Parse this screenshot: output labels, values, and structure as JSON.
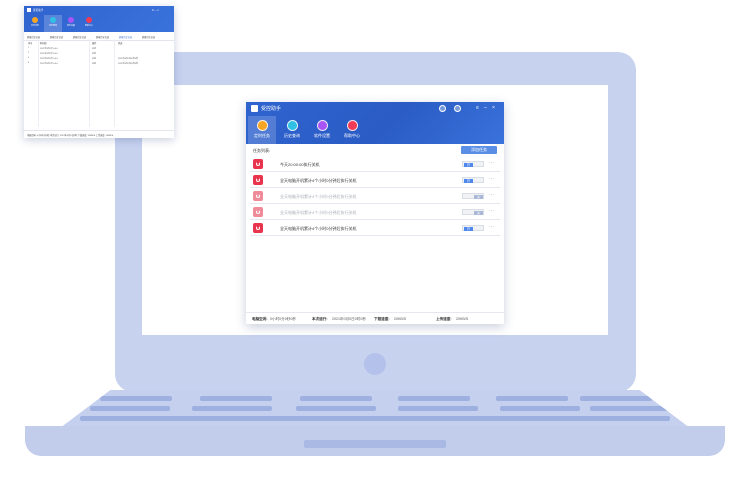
{
  "window": {
    "title": "受控助手",
    "controls": {
      "menu": "≡",
      "minimize": "–",
      "close": "×"
    },
    "tabs": [
      {
        "label": "定时任务",
        "color": "#f6a623",
        "active": true
      },
      {
        "label": "历史查询",
        "color": "#2fc0e4",
        "active": false
      },
      {
        "label": "软件设置",
        "color": "#a855f7",
        "active": false
      },
      {
        "label": "帮助中心",
        "color": "#ef3b56",
        "active": false
      }
    ],
    "list_title": "任务列表:",
    "add_button": "添加任务",
    "tasks": [
      {
        "text": "今天20:00:00执行关机",
        "toggle": "开",
        "enabled": true
      },
      {
        "text": "全天电脑开机累计4个小时0分钟后执行关机",
        "toggle": "开",
        "enabled": true
      },
      {
        "text": "全天电脑开机累计4个小时0分钟后执行关机",
        "toggle": "关",
        "enabled": false
      },
      {
        "text": "全天电脑开机累计4个小时0分钟后执行关机",
        "toggle": "关",
        "enabled": false
      },
      {
        "text": "全天电脑开机累计4个小时0分钟后执行关机",
        "toggle": "开",
        "enabled": true
      }
    ],
    "more": "···",
    "status": {
      "uptime_label": "电脑空闲:",
      "uptime_value": "0小时0分0秒0秒",
      "run_label": "本次运行:",
      "run_value": "2021年0月0日0时0秒",
      "download_label": "下载速度:",
      "download_value": "20KB/S",
      "upload_label": "上传速度:",
      "upload_value": "20KB/S"
    }
  },
  "mini_window": {
    "title": "受控助手",
    "controls": "≡ – ×",
    "tabs": [
      {
        "label": "定时任务",
        "color": "#f6a623",
        "active": false
      },
      {
        "label": "历史查询",
        "color": "#2fc0e4",
        "active": true
      },
      {
        "label": "软件设置",
        "color": "#a855f7",
        "active": false
      },
      {
        "label": "帮助中心",
        "color": "#ef3b56",
        "active": false
      }
    ],
    "subtabs": [
      "屏幕历史记录",
      "屏幕历史记录",
      "屏幕历史记录",
      "屏幕历史记录",
      "屏幕历史记录",
      "屏幕历史记录"
    ],
    "headers": [
      "序号",
      "时间段",
      "操作",
      "状态"
    ],
    "rows": [
      [
        "1",
        "2021年0月0日 0:0:0",
        "关机",
        ""
      ],
      [
        "2",
        "2021年0月0日 0:0:0",
        "关机",
        ""
      ],
      [
        "3",
        "2021年0月0日 0:0:0",
        "关机",
        "2021年0月0日00时0秒"
      ],
      [
        "4",
        "2021年0月0日 0:0:0",
        "关机",
        "2021年0月0日00时0秒"
      ]
    ],
    "status": "电脑空闲: 0小时0分0秒   本次运行: 2021年0月0日0时  下载速度: 20KB/S          上传速度: 20KB/S"
  }
}
